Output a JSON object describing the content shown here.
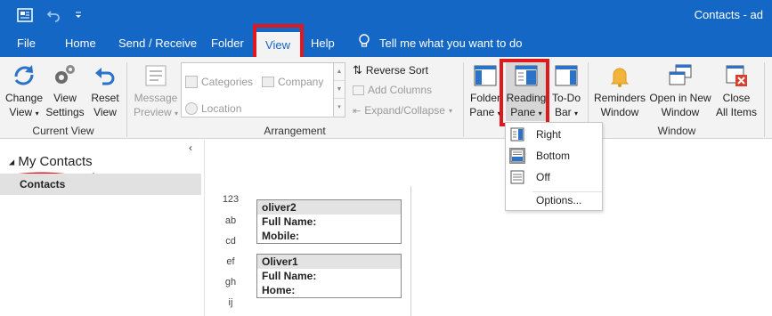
{
  "window": {
    "title": "Contacts - ad"
  },
  "menu": {
    "tabs": [
      "File",
      "Home",
      "Send / Receive",
      "Folder",
      "View",
      "Help"
    ],
    "active_tab": "View",
    "tell_me": "Tell me what you want to do"
  },
  "ribbon": {
    "current_view": {
      "label": "Current View",
      "change_view": [
        "Change",
        "View"
      ],
      "view_settings": [
        "View",
        "Settings"
      ],
      "reset_view": [
        "Reset",
        "View"
      ]
    },
    "arrangement": {
      "label": "Arrangement",
      "message_preview": [
        "Message",
        "Preview"
      ],
      "categories": "Categories",
      "company": "Company",
      "location": "Location",
      "reverse_sort": "Reverse Sort",
      "add_columns": "Add Columns",
      "expand_collapse": "Expand/Collapse"
    },
    "layout": {
      "folder_pane": [
        "Folder",
        "Pane"
      ],
      "reading_pane": [
        "Reading",
        "Pane"
      ],
      "todo_bar": [
        "To-Do",
        "Bar"
      ]
    },
    "window": {
      "label": "Window",
      "reminders": [
        "Reminders",
        "Window"
      ],
      "open_new": [
        "Open in New",
        "Window"
      ],
      "close_all": [
        "Close",
        "All Items"
      ]
    }
  },
  "reading_pane_menu": {
    "items": [
      "Right",
      "Bottom",
      "Off"
    ],
    "selected": "Bottom",
    "options": "Options..."
  },
  "nav": {
    "section": "My Contacts",
    "item": "Contacts"
  },
  "alphabet": [
    "123",
    "ab",
    "cd",
    "ef",
    "gh",
    "ij"
  ],
  "cards": [
    {
      "name": "oliver2",
      "fields": [
        "Full Name:",
        "Mobile:"
      ]
    },
    {
      "name": "Oliver1",
      "fields": [
        "Full Name:",
        "Home:"
      ]
    }
  ],
  "colors": {
    "accent": "#1467c4",
    "highlight": "#e0191f"
  }
}
